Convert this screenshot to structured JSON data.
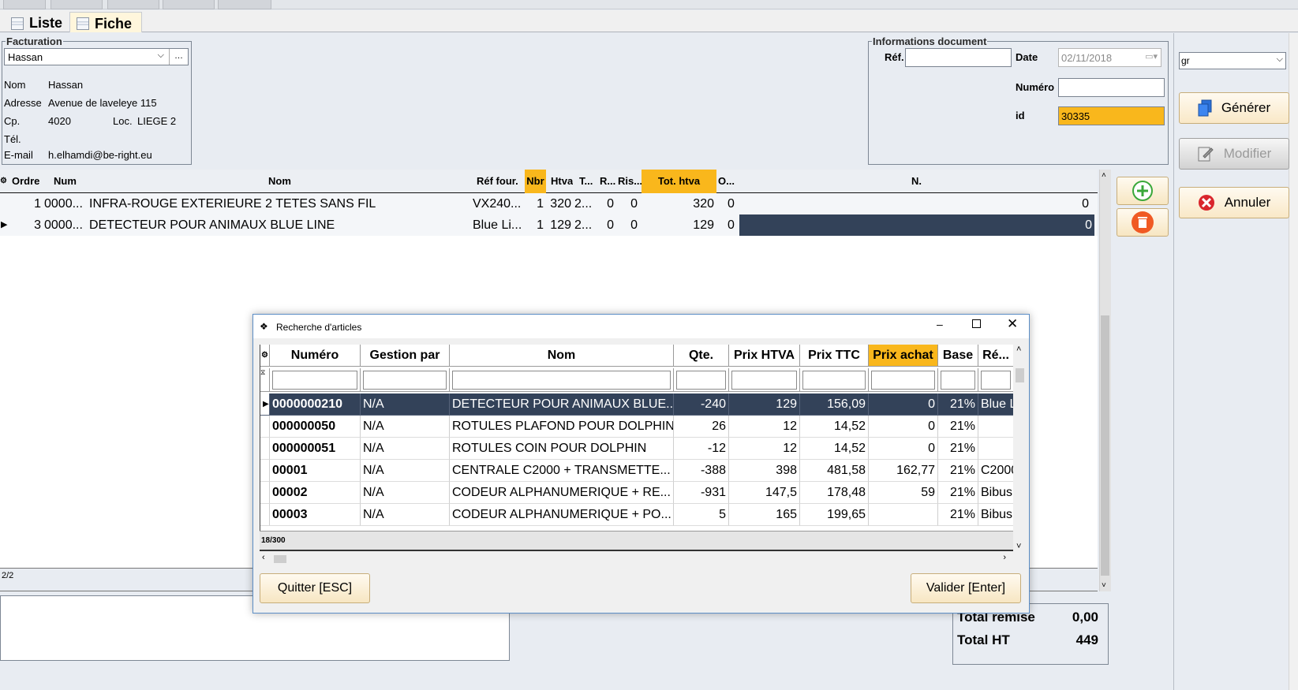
{
  "tabs": [
    {
      "label": "Liste",
      "active": false
    },
    {
      "label": "Fiche",
      "active": true
    }
  ],
  "facturation": {
    "title": "Facturation",
    "client_select": "Hassan",
    "nom_label": "Nom",
    "nom_value": "Hassan",
    "adresse_label": "Adresse",
    "adresse_value": "Avenue de laveleye 115",
    "cp_label": "Cp.",
    "cp_value": "4020",
    "loc_label": "Loc.",
    "loc_value": "LIEGE 2",
    "tel_label": "Tél.",
    "tel_value": "",
    "email_label": "E-mail",
    "email_value": "h.elhamdi@be-right.eu"
  },
  "document_info": {
    "title": "Informations document",
    "ref_label": "Réf.",
    "ref_value": "",
    "date_label": "Date",
    "date_value": "02/11/2018",
    "numero_label": "Numéro",
    "numero_value": "",
    "id_label": "id",
    "id_value": "30335"
  },
  "right_panel": {
    "select_value": "gr",
    "generate_label": "Générer",
    "modify_label": "Modifier",
    "cancel_label": "Annuler"
  },
  "grid": {
    "headers": {
      "ordre": "Ordre",
      "num": "Num",
      "nom": "Nom",
      "ref_four": "Réf four.",
      "nbr": "Nbr",
      "htva": "Htva",
      "t": "T...",
      "r": "R...",
      "ris": "Ris...",
      "tot_htva": "Tot. htva",
      "o": "O...",
      "n": "N."
    },
    "rows": [
      {
        "ordre": "1",
        "num": "0000...",
        "nom": "INFRA-ROUGE EXTERIEURE 2 TETES SANS FIL",
        "ref_four": "VX240...",
        "nbr": "1",
        "htva": "320",
        "t": "2...",
        "r": "0",
        "ris": "0",
        "tot_htva": "320",
        "o": "0",
        "n": "0"
      },
      {
        "ordre": "3",
        "num": "0000...",
        "nom": "DETECTEUR POUR ANIMAUX BLUE LINE",
        "ref_four": "Blue Li...",
        "nbr": "1",
        "htva": "129",
        "t": "2...",
        "r": "0",
        "ris": "0",
        "tot_htva": "129",
        "o": "0",
        "n": "0"
      }
    ],
    "footer_count": "2/2"
  },
  "totals": {
    "remise_label": "Total remise",
    "remise_value": "0,00",
    "ht_label": "Total HT",
    "ht_value": "449"
  },
  "dialog": {
    "title": "Recherche d'articles",
    "headers": {
      "numero": "Numéro",
      "gestion": "Gestion par",
      "nom": "Nom",
      "qte": "Qte.",
      "prix_htva": "Prix HTVA",
      "prix_ttc": "Prix TTC",
      "prix_achat": "Prix achat",
      "base": "Base",
      "ref": "Ré..."
    },
    "rows": [
      {
        "numero": "0000000210",
        "gestion": "N/A",
        "nom": "DETECTEUR POUR ANIMAUX BLUE...",
        "qte": "-240",
        "prix_htva": "129",
        "prix_ttc": "156,09",
        "prix_achat": "0",
        "base": "21%",
        "ref": "Blue Li"
      },
      {
        "numero": "000000050",
        "gestion": "N/A",
        "nom": "ROTULES PLAFOND POUR DOLPHIN",
        "qte": "26",
        "prix_htva": "12",
        "prix_ttc": "14,52",
        "prix_achat": "0",
        "base": "21%",
        "ref": ""
      },
      {
        "numero": "000000051",
        "gestion": "N/A",
        "nom": "ROTULES COIN POUR DOLPHIN",
        "qte": "-12",
        "prix_htva": "12",
        "prix_ttc": "14,52",
        "prix_achat": "0",
        "base": "21%",
        "ref": ""
      },
      {
        "numero": "00001",
        "gestion": "N/A",
        "nom": "CENTRALE C2000 + TRANSMETTE...",
        "qte": "-388",
        "prix_htva": "398",
        "prix_ttc": "481,58",
        "prix_achat": "162,77",
        "base": "21%",
        "ref": "C2000"
      },
      {
        "numero": "00002",
        "gestion": "N/A",
        "nom": "CODEUR ALPHANUMERIQUE + RE...",
        "qte": "-931",
        "prix_htva": "147,5",
        "prix_ttc": "178,48",
        "prix_achat": "59",
        "base": "21%",
        "ref": "Bibus"
      },
      {
        "numero": "00003",
        "gestion": "N/A",
        "nom": "CODEUR ALPHANUMERIQUE + PO...",
        "qte": "5",
        "prix_htva": "165",
        "prix_ttc": "199,65",
        "prix_achat": "",
        "base": "21%",
        "ref": "Bibus"
      }
    ],
    "status": "18/300",
    "quit_label": "Quitter [ESC]",
    "validate_label": "Valider [Enter]"
  },
  "colors": {
    "highlight": "#f9b71c",
    "selection": "#334259",
    "background": "#e8ecf2"
  }
}
